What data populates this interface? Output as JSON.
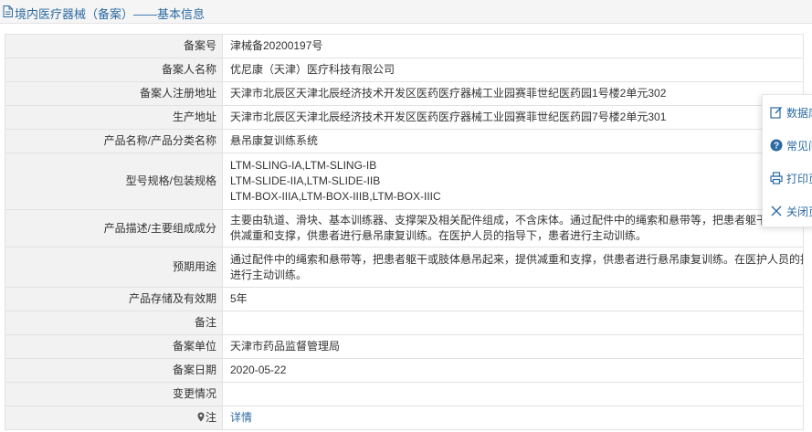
{
  "header": {
    "title": "境内医疗器械（备案）——基本信息"
  },
  "rows": [
    {
      "label": "备案号",
      "value": "津械备20200197号"
    },
    {
      "label": "备案人名称",
      "value": "优尼康（天津）医疗科技有限公司"
    },
    {
      "label": "备案人注册地址",
      "value": "天津市北辰区天津北辰经济技术开发区医药医疗器械工业园赛菲世纪医药园1号楼2单元302"
    },
    {
      "label": "生产地址",
      "value": "天津市北辰区天津北辰经济技术开发区医药医疗器械工业园赛菲世纪医药园7号楼2单元301"
    },
    {
      "label": "产品名称/产品分类名称",
      "value": "悬吊康复训练系统"
    },
    {
      "label": "型号规格/包装规格",
      "lines": [
        "LTM-SLING-IA,LTM-SLING-IB",
        "LTM-SLIDE-IIA,LTM-SLIDE-IIB",
        "LTM-BOX-IIIA,LTM-BOX-IIIB,LTM-BOX-IIIC"
      ]
    },
    {
      "label": "产品描述/主要组成成分",
      "lines": [
        "主要由轨道、滑块、基本训练器、支撑架及相关配件组成，不含床体。通过配件中的绳索和悬带等，把患者躯干或肢体悬吊起来，提",
        "供减重和支撑，供患者进行悬吊康复训练。在医护人员的指导下，患者进行主动训练。"
      ]
    },
    {
      "label": "预期用途",
      "lines": [
        "通过配件中的绳索和悬带等，把患者躯干或肢体悬吊起来，提供减重和支撑，供患者进行悬吊康复训练。在医护人员的指导下，患者",
        "进行主动训练。"
      ]
    },
    {
      "label": "产品存储及有效期",
      "value": "5年"
    },
    {
      "label": "备注",
      "value": ""
    },
    {
      "label": "备案单位",
      "value": "天津市药品监督管理局"
    },
    {
      "label": "备案日期",
      "value": "2020-05-22"
    },
    {
      "label": "变更情况",
      "value": ""
    },
    {
      "label": "注",
      "value": "详情"
    }
  ],
  "side_panel": {
    "items": [
      {
        "label": "数据库",
        "icon": "edit-icon"
      },
      {
        "label": "常见问",
        "icon": "help-icon"
      },
      {
        "label": "打印页",
        "icon": "print-icon"
      },
      {
        "label": "关闭页",
        "icon": "close-icon"
      }
    ]
  },
  "colors": {
    "accent": "#2b6aa3",
    "label_bg": "#f2f2f2",
    "border": "#e2e2e2"
  }
}
